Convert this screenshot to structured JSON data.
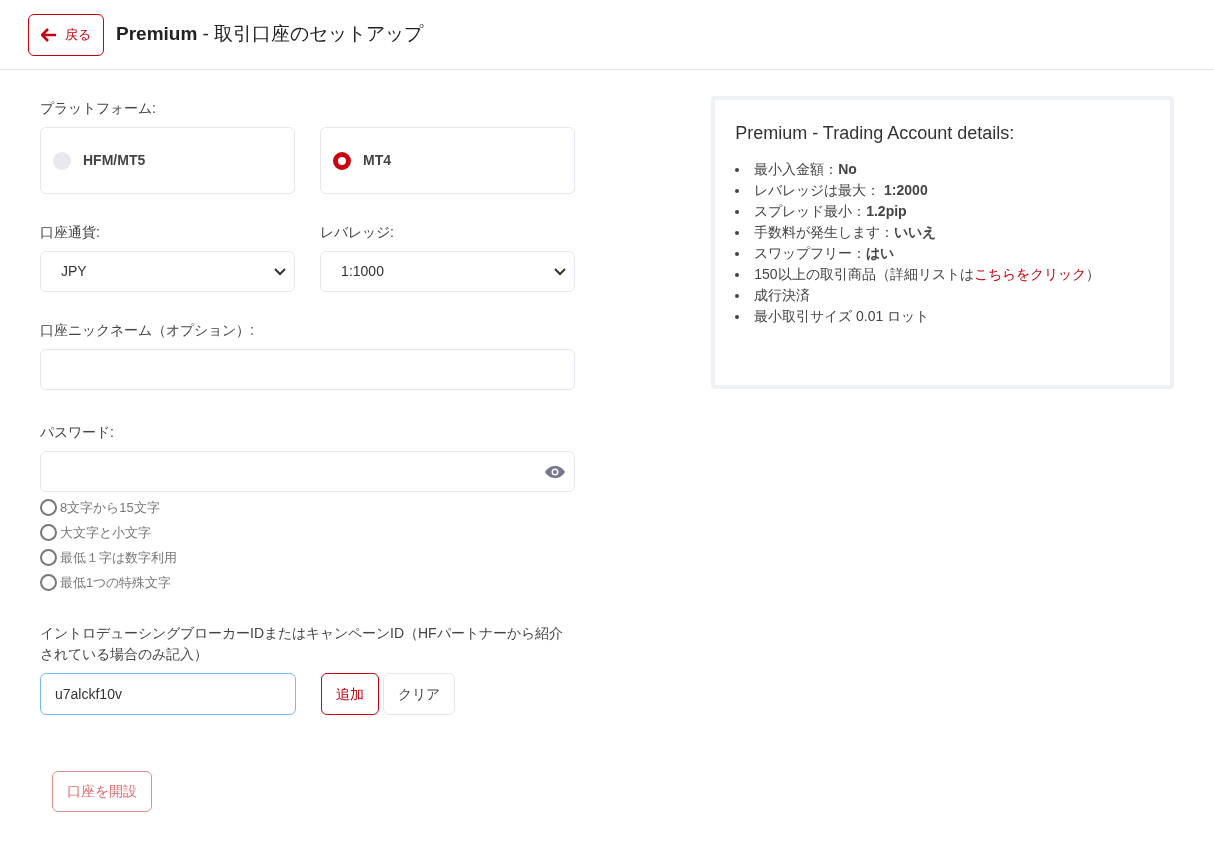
{
  "header": {
    "back_button": "戻る",
    "title_bold": "Premium",
    "title_rest": " - 取引口座のセットアップ"
  },
  "form": {
    "platform_label": "プラットフォーム:",
    "platforms": [
      {
        "label": "HFM/MT5",
        "selected": false
      },
      {
        "label": "MT4",
        "selected": true
      }
    ],
    "currency": {
      "label": "口座通貨:",
      "value": "JPY"
    },
    "leverage": {
      "label": "レバレッジ:",
      "value": "1:1000"
    },
    "nickname": {
      "label": "口座ニックネーム（オプション）:"
    },
    "password": {
      "label": "パスワード:",
      "requirements": [
        {
          "text": "8文字から15文字",
          "met": false
        },
        {
          "text": "大文字と小文字",
          "met": false
        },
        {
          "text": "最低１字は数字利用",
          "met": false
        },
        {
          "text": "最低1つの特殊文字",
          "met": false
        }
      ]
    },
    "ib": {
      "label": "イントロデューシングブローカーIDまたはキャンペーンID（HFパートナーから紹介されている場合のみ記入）",
      "value": "u7alckf10v",
      "add_button": "追加",
      "clear_button": "クリア"
    },
    "submit": {
      "label": "口座を開設",
      "disabled": true
    }
  },
  "details": {
    "title": "Premium - Trading Account details:",
    "items": [
      {
        "kind": "text",
        "text": "最小入金額：**No**"
      },
      {
        "kind": "text",
        "text": "レバレッジは最大： **1:2000**"
      },
      {
        "kind": "text",
        "text": "スプレッド最小：**1.2pip**"
      },
      {
        "kind": "text",
        "text": "手数料が発生します：**いいえ**"
      },
      {
        "kind": "text",
        "text": "スワップフリー：**はい**"
      },
      {
        "kind": "link",
        "before": "150以上の取引商品（詳細リストは",
        "link": "こちらをクリック",
        "after": "）"
      },
      {
        "kind": "text",
        "text": "成行決済"
      },
      {
        "kind": "text",
        "text": "最小取引サイズ 0.01 ロット"
      }
    ]
  }
}
